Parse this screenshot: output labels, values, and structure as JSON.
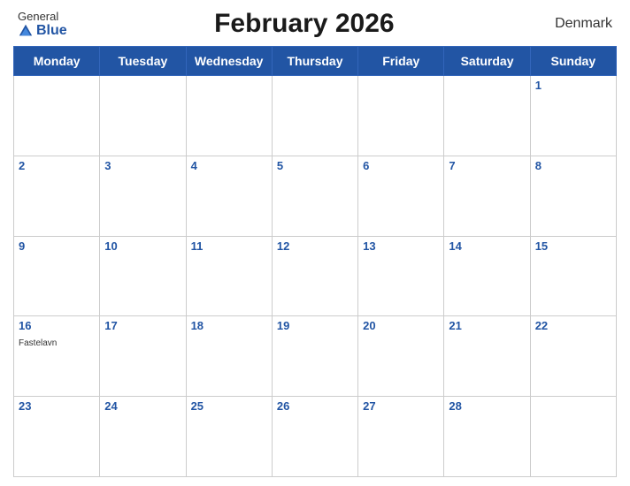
{
  "header": {
    "logo_general": "General",
    "logo_blue": "Blue",
    "title": "February 2026",
    "country": "Denmark"
  },
  "days_of_week": [
    "Monday",
    "Tuesday",
    "Wednesday",
    "Thursday",
    "Friday",
    "Saturday",
    "Sunday"
  ],
  "weeks": [
    [
      {
        "num": null,
        "holiday": ""
      },
      {
        "num": null,
        "holiday": ""
      },
      {
        "num": null,
        "holiday": ""
      },
      {
        "num": null,
        "holiday": ""
      },
      {
        "num": null,
        "holiday": ""
      },
      {
        "num": null,
        "holiday": ""
      },
      {
        "num": "1",
        "holiday": ""
      }
    ],
    [
      {
        "num": "2",
        "holiday": ""
      },
      {
        "num": "3",
        "holiday": ""
      },
      {
        "num": "4",
        "holiday": ""
      },
      {
        "num": "5",
        "holiday": ""
      },
      {
        "num": "6",
        "holiday": ""
      },
      {
        "num": "7",
        "holiday": ""
      },
      {
        "num": "8",
        "holiday": ""
      }
    ],
    [
      {
        "num": "9",
        "holiday": ""
      },
      {
        "num": "10",
        "holiday": ""
      },
      {
        "num": "11",
        "holiday": ""
      },
      {
        "num": "12",
        "holiday": ""
      },
      {
        "num": "13",
        "holiday": ""
      },
      {
        "num": "14",
        "holiday": ""
      },
      {
        "num": "15",
        "holiday": ""
      }
    ],
    [
      {
        "num": "16",
        "holiday": "Fastelavn"
      },
      {
        "num": "17",
        "holiday": ""
      },
      {
        "num": "18",
        "holiday": ""
      },
      {
        "num": "19",
        "holiday": ""
      },
      {
        "num": "20",
        "holiday": ""
      },
      {
        "num": "21",
        "holiday": ""
      },
      {
        "num": "22",
        "holiday": ""
      }
    ],
    [
      {
        "num": "23",
        "holiday": ""
      },
      {
        "num": "24",
        "holiday": ""
      },
      {
        "num": "25",
        "holiday": ""
      },
      {
        "num": "26",
        "holiday": ""
      },
      {
        "num": "27",
        "holiday": ""
      },
      {
        "num": "28",
        "holiday": ""
      },
      {
        "num": null,
        "holiday": ""
      }
    ]
  ],
  "colors": {
    "header_bg": "#2255a4",
    "header_text": "#ffffff",
    "title_color": "#1a1a1a",
    "day_num_color": "#2255a4"
  }
}
